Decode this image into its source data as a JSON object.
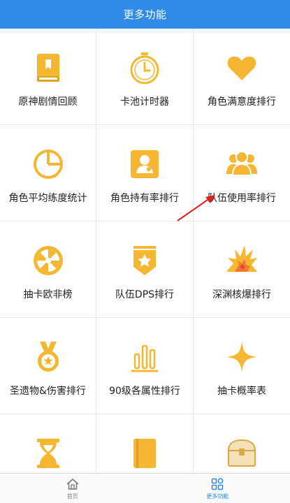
{
  "header": {
    "title": "更多功能"
  },
  "accent_color": "#2f8ae8",
  "icon_color": "#f5b731",
  "grid": {
    "items": [
      {
        "label": "原神剧情回顾",
        "icon": "book-icon"
      },
      {
        "label": "卡池计时器",
        "icon": "stopwatch-icon"
      },
      {
        "label": "角色满意度排行",
        "icon": "heart-icon"
      },
      {
        "label": "角色平均练度统计",
        "icon": "pie-chart-icon"
      },
      {
        "label": "角色持有率排行",
        "icon": "user-card-icon"
      },
      {
        "label": "队伍使用率排行",
        "icon": "group-icon"
      },
      {
        "label": "抽卡欧非榜",
        "icon": "wheel-icon"
      },
      {
        "label": "队伍DPS排行",
        "icon": "star-badge-icon"
      },
      {
        "label": "深渊核爆排行",
        "icon": "explosion-icon"
      },
      {
        "label": "圣遗物&伤害排行",
        "icon": "medal-icon"
      },
      {
        "label": "90级各属性排行",
        "icon": "bar-chart-icon"
      },
      {
        "label": "抽卡概率表",
        "icon": "sparkle-icon"
      },
      {
        "label": "",
        "icon": "hourglass-icon"
      },
      {
        "label": "",
        "icon": "notebook-icon"
      },
      {
        "label": "",
        "icon": "treasure-chest-icon"
      }
    ]
  },
  "tabbar": {
    "home_label": "首页",
    "more_label": "更多功能"
  }
}
